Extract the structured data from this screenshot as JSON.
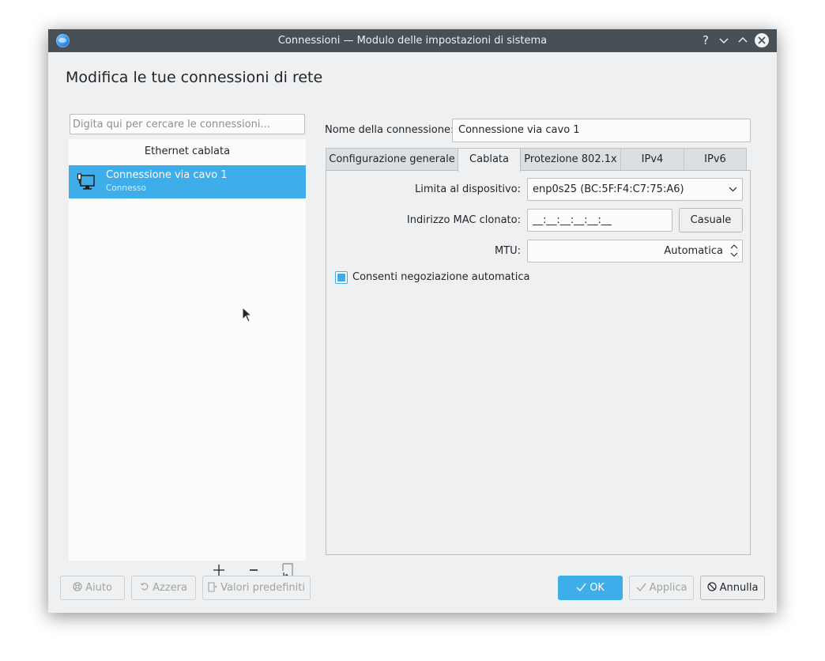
{
  "window": {
    "title": "Connessioni — Modulo delle impostazioni di sistema",
    "help_glyph": "?",
    "minimize_glyph": "⌄",
    "maximize_glyph": "⌃",
    "close_glyph": "✕"
  },
  "page_title": "Modifica le tue connessioni di rete",
  "sidebar": {
    "search_placeholder": "Digita qui per cercare le connessioni...",
    "group_header": "Ethernet cablata",
    "items": [
      {
        "name": "Connessione via cavo 1",
        "status": "Connesso",
        "icon": "wired-network-icon",
        "selected": true
      }
    ],
    "actions": {
      "add_glyph": "+",
      "remove_glyph": "−",
      "export_glyph": "⍈"
    }
  },
  "connection": {
    "name_label": "Nome della connessione:",
    "name_value": "Connessione via cavo 1"
  },
  "tabs": [
    {
      "label": "Configurazione generale",
      "active": false
    },
    {
      "label": "Cablata",
      "active": true
    },
    {
      "label": "Protezione 802.1x",
      "active": false
    },
    {
      "label": "IPv4",
      "active": false
    },
    {
      "label": "IPv6",
      "active": false
    }
  ],
  "wired": {
    "device_label": "Limita al dispositivo:",
    "device_value": "enp0s25 (BC:5F:F4:C7:75:A6)",
    "mac_label": "Indirizzo MAC clonato:",
    "mac_value": "__:__:__:__:__:__",
    "random_button": "Casuale",
    "mtu_label": "MTU:",
    "mtu_value": "Automatica",
    "autoneg_label": "Consenti negoziazione automatica",
    "autoneg_checked": true
  },
  "footer": {
    "help": "Aiuto",
    "reset": "Azzera",
    "defaults": "Valori predefiniti",
    "ok": "OK",
    "apply": "Applica",
    "cancel": "Annulla"
  },
  "colors": {
    "accent": "#3daee9",
    "titlebar": "#475057",
    "window_bg": "#eff0f1"
  }
}
